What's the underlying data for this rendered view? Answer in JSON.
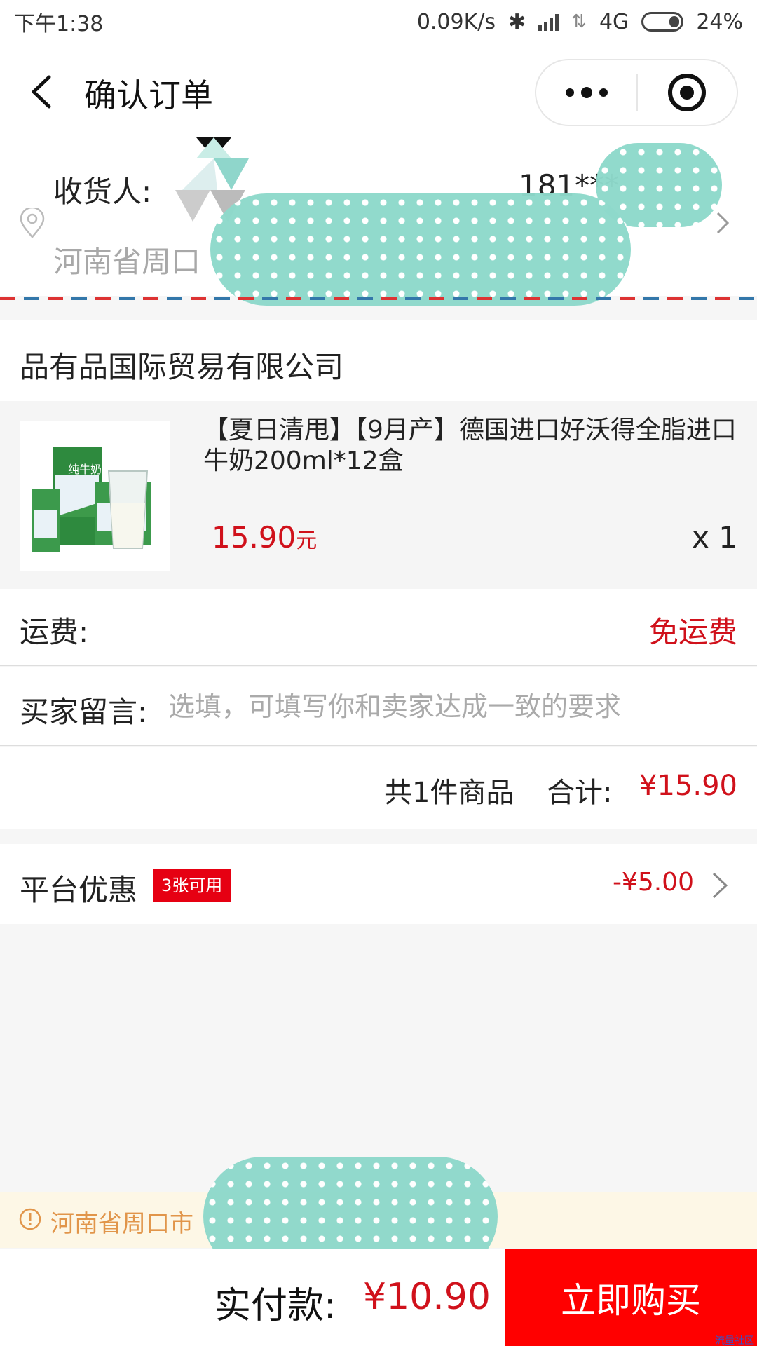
{
  "status_bar": {
    "time": "下午1:38",
    "network_speed": "0.09K/s",
    "network_type": "4G",
    "battery": "24%"
  },
  "header": {
    "title": "确认订单",
    "back_icon": "back-arrow-icon",
    "more_icon": "more-dots-icon",
    "close_icon": "target-circle-icon"
  },
  "address": {
    "receiver_label": "收货人:",
    "phone": "181***",
    "address_line": "河南省周口"
  },
  "shop": {
    "name": "品有品国际贸易有限公司"
  },
  "product": {
    "title": "【夏日清甩】【9月产】德国进口好沃得全脂进口牛奶200ml*12盒",
    "price": "15.90",
    "price_unit": "元",
    "quantity": "x 1"
  },
  "shipping": {
    "label": "运费:",
    "value": "免运费"
  },
  "note": {
    "label": "买家留言:",
    "placeholder": "选填，可填写你和卖家达成一致的要求",
    "value": ""
  },
  "summary": {
    "count_text": "共1件商品",
    "total_label": "合计:",
    "total_value": "¥15.90"
  },
  "coupon": {
    "label": "平台优惠",
    "badge": "3张可用",
    "value": "-¥5.00"
  },
  "notice": {
    "text": "河南省周口市"
  },
  "bottom": {
    "pay_label": "实付款:",
    "pay_value": "¥10.90",
    "buy_button": "立即购买"
  },
  "watermark": "流量社区",
  "colors": {
    "accent_red": "#d0111b",
    "buy_button_bg": "#ff0000",
    "notice_text": "#e1954a",
    "mask_teal": "#8ed9cb"
  }
}
